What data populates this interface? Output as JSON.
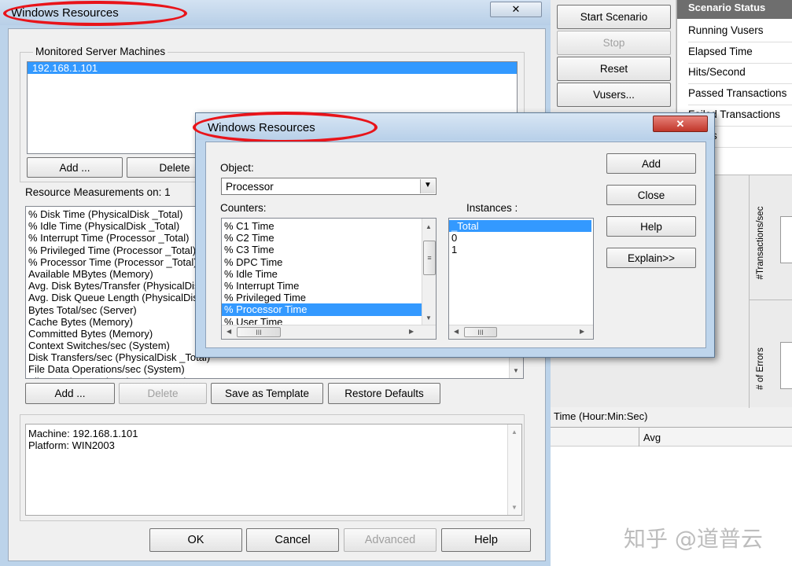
{
  "back_dialog": {
    "title": "Windows Resources",
    "monitored_group_label": "Monitored Server Machines",
    "machines": [
      "192.168.1.101"
    ],
    "machine_buttons": {
      "add": "Add ...",
      "delete": "Delete"
    },
    "resource_label": "Resource Measurements on: 1",
    "resources": [
      "% Disk Time (PhysicalDisk _Total)",
      "% Idle Time (PhysicalDisk _Total)",
      "% Interrupt Time (Processor _Total)",
      "% Privileged Time (Processor _Total)",
      "% Processor Time (Processor _Total)",
      "Available MBytes (Memory)",
      "Avg. Disk Bytes/Transfer (PhysicalDisk _Total)",
      "Avg. Disk Queue Length (PhysicalDisk _Total)",
      "Bytes Total/sec (Server)",
      "Cache Bytes (Memory)",
      "Committed Bytes (Memory)",
      "Context Switches/sec (System)",
      "Disk Transfers/sec (PhysicalDisk _Total)",
      "File Data Operations/sec (System)",
      "File Read Operations/sec (System)"
    ],
    "resource_buttons": {
      "add": "Add ...",
      "delete": "Delete",
      "save_template": "Save as Template",
      "restore_defaults": "Restore Defaults"
    },
    "description": [
      "Machine: 192.168.1.101",
      "Platform: WIN2003"
    ],
    "footer_buttons": {
      "ok": "OK",
      "cancel": "Cancel",
      "advanced": "Advanced",
      "help": "Help"
    }
  },
  "controller": {
    "buttons": {
      "start": "Start Scenario",
      "stop": "Stop",
      "reset": "Reset",
      "vusers": "Vusers..."
    },
    "status_header": "Scenario Status",
    "status_rows": [
      "Running Vusers",
      "Elapsed Time",
      "Hits/Second",
      "Passed Transactions",
      "Failed Transactions",
      "Errors"
    ],
    "graph_labels": {
      "transactions": "#Transactions/sec",
      "errors": "# of Errors"
    },
    "time_label": "Time (Hour:Min:Sec)",
    "avg_header": "Avg"
  },
  "front_dialog": {
    "title": "Windows Resources",
    "object_label": "Object:",
    "object_value": "Processor",
    "counters_label": "Counters:",
    "counters": [
      "% C1 Time",
      "% C2 Time",
      "% C3 Time",
      "% DPC Time",
      "% Idle Time",
      "% Interrupt Time",
      "% Privileged Time",
      "% Processor Time",
      "% User Time"
    ],
    "counters_selected": 7,
    "instances_label": "Instances :",
    "instances": [
      "_Total",
      "0",
      "1"
    ],
    "instances_selected": 0,
    "buttons": {
      "add": "Add",
      "close": "Close",
      "help": "Help",
      "explain": "Explain>>"
    },
    "close_glyph": "✕"
  },
  "annotation_color": "#e8141a",
  "selection_color": "#3399ff",
  "status_header_color": "#6e6e6e",
  "watermark": "知乎 @道普云"
}
